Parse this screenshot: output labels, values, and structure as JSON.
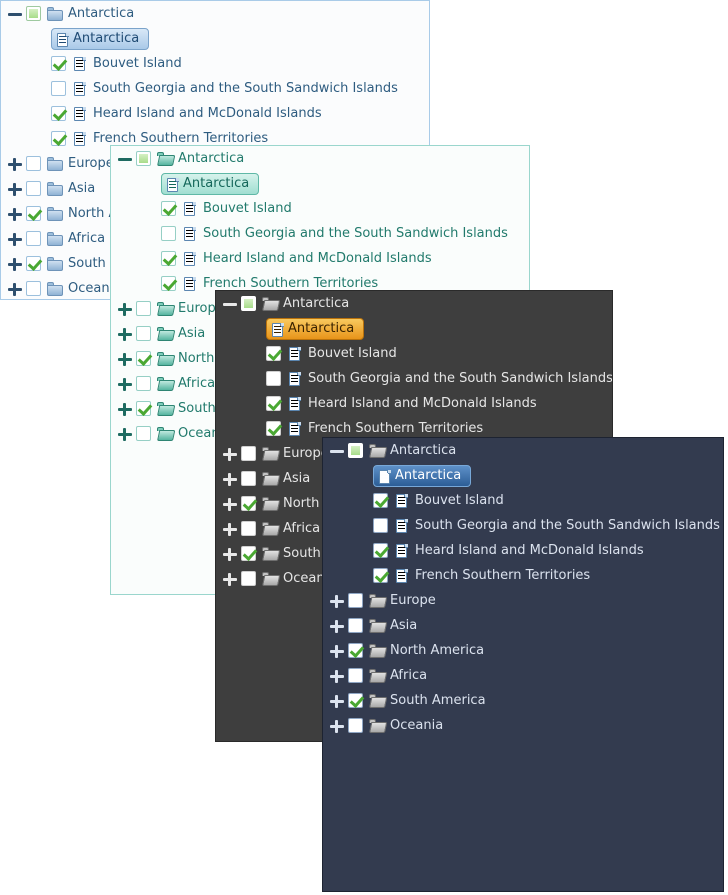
{
  "tree": {
    "root": {
      "label": "Antarctica",
      "icon": "folder-icon",
      "toggle": "minus",
      "check_state": "partial",
      "expanded": true
    },
    "children": [
      {
        "label": "Antarctica",
        "icon": "document-icon",
        "check_state": "unchecked",
        "selected": true
      },
      {
        "label": "Bouvet Island",
        "icon": "document-icon",
        "check_state": "checked",
        "selected": false
      },
      {
        "label": "South Georgia and the South Sandwich Islands",
        "icon": "document-icon",
        "check_state": "unchecked",
        "selected": false
      },
      {
        "label": "Heard Island and McDonald Islands",
        "icon": "document-icon",
        "check_state": "checked",
        "selected": false
      },
      {
        "label": "French Southern Territories",
        "icon": "document-icon",
        "check_state": "checked",
        "selected": false
      }
    ],
    "siblings": [
      {
        "label": "Europe",
        "icon": "folder-icon",
        "toggle": "plus",
        "check_state": "unchecked"
      },
      {
        "label": "Asia",
        "icon": "folder-icon",
        "toggle": "plus",
        "check_state": "unchecked"
      },
      {
        "label": "North America",
        "icon": "folder-icon",
        "toggle": "plus",
        "check_state": "checked"
      },
      {
        "label": "Africa",
        "icon": "folder-icon",
        "toggle": "plus",
        "check_state": "unchecked"
      },
      {
        "label": "South America",
        "icon": "folder-icon",
        "toggle": "plus",
        "check_state": "checked"
      },
      {
        "label": "Oceania",
        "icon": "folder-icon",
        "toggle": "plus",
        "check_state": "unchecked"
      }
    ]
  },
  "panels": [
    {
      "id": "p1",
      "theme_name": "light-blue",
      "folder_style": "closed",
      "colors": {
        "background": "#fbfcfd",
        "border": "#a9cbe8",
        "text": "#2e5c80",
        "selection": "#a9c9e8",
        "selection_text": "#204b74",
        "checkbox_border": "#9cc0dd",
        "check_mark": "#4aa832"
      }
    },
    {
      "id": "p2",
      "theme_name": "light-green",
      "folder_style": "open",
      "colors": {
        "background": "#fafdfc",
        "border": "#9ad6cd",
        "text": "#217a6c",
        "selection": "#a0ded1",
        "selection_text": "#14675a",
        "checkbox_border": "#96cfc5",
        "check_mark": "#4aa832"
      }
    },
    {
      "id": "p3",
      "theme_name": "dark-grey",
      "folder_style": "open",
      "colors": {
        "background": "#3e3e3e",
        "border": "#2a2a2a",
        "text": "#e6e6e6",
        "selection": "#e8941a",
        "selection_text": "#3a2300",
        "checkbox_border": "#cfcfcf",
        "check_mark": "#4aa832"
      }
    },
    {
      "id": "p4",
      "theme_name": "dark-navy",
      "folder_style": "open",
      "colors": {
        "background": "#333b4f",
        "border": "#1d2331",
        "text": "#dbe2ee",
        "selection": "#2c5d96",
        "selection_text": "#ffffff",
        "checkbox_border": "#8fa6c4",
        "check_mark": "#4aa832"
      }
    }
  ]
}
